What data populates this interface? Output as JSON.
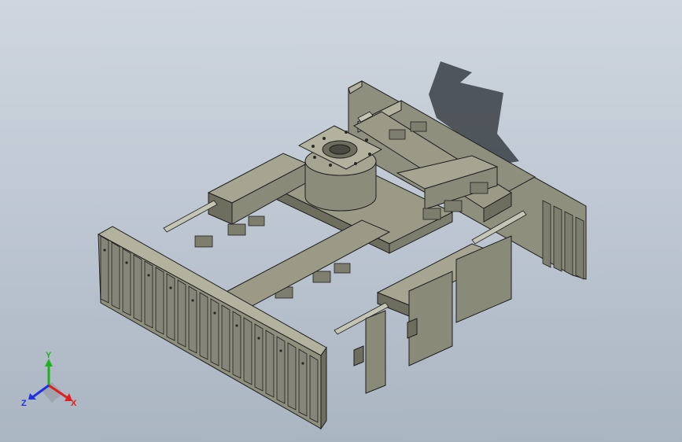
{
  "scene": {
    "type": "cad-3d-viewport",
    "background_top": "#cfd6df",
    "background_bottom": "#aab5c2",
    "part_color": "#8f8f7e",
    "part_dark": "#6e6e5f",
    "part_light": "#b2b29f",
    "edge_color": "#1e1e1e",
    "shadow_color": "#3a3f45"
  },
  "triad": {
    "x_label": "X",
    "y_label": "Y",
    "z_label": "Z",
    "x_color": "#e02020",
    "y_color": "#20b020",
    "z_color": "#2030e0"
  }
}
